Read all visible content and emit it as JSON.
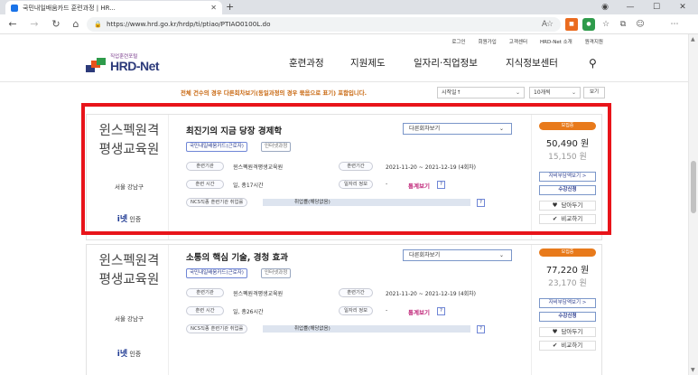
{
  "browser": {
    "tab_title": "국민내일배움카드 훈련과정 | HR...",
    "url": "https://www.hrd.go.kr/hrdp/ti/ptiao/PTIAO0100L.do"
  },
  "header": {
    "util_nav": [
      "로그인",
      "회원가입",
      "고객센터",
      "HRD-Net 소개",
      "원격지원"
    ],
    "logo_sub": "직업훈련포털",
    "logo_main": "HRD-Net",
    "main_nav": [
      "훈련과정",
      "지원제도",
      "일자리·직업정보",
      "지식정보센터"
    ]
  },
  "filter": {
    "notice": "전체 건수의 경우 다른회차보기(동일과정의 경우 묶음으로 표기) 포함입니다.",
    "sort_selected": "시작일↑",
    "page_size_selected": "10개씩",
    "view_button": "보기"
  },
  "courses": [
    {
      "org_line1": "윈스펙원격",
      "org_line2": "평생교육원",
      "location": "서울 강남구",
      "cert": "인증",
      "title": "최진기의 지금 당장 경제학",
      "round_select": "다른회차보기",
      "tags": [
        "국민내일배움카드(근로자)",
        "인터넷과정"
      ],
      "labels": {
        "org": "훈련기관",
        "period": "훈련기간",
        "time": "훈련 시간",
        "job": "일자리 정보",
        "ncs": "NCS직종 훈련기관 취업률"
      },
      "org_value": "윈스펙원격평생교육원",
      "period_value": "2021-11-20 ~ 2021-12-19 (4회차)",
      "time_value": "일, 총17시간",
      "job_value": "-",
      "stats_link": "통계보기",
      "ncs_value": "취업률(해당없음)",
      "badge": "모집중",
      "price": "50,490 원",
      "sub_price": "15,150 원",
      "self_pay_btn": "자비부담액보기 >",
      "apply_btn": "수강신청",
      "save_btn": "담아두기",
      "compare_btn": "비교하기"
    },
    {
      "org_line1": "윈스펙원격",
      "org_line2": "평생교육원",
      "location": "서울 강남구",
      "cert": "인증",
      "title": "소통의 핵심 기술, 경청 효과",
      "round_select": "다른회차보기",
      "tags": [
        "국민내일배움카드(근로자)",
        "인터넷과정"
      ],
      "labels": {
        "org": "훈련기관",
        "period": "훈련기간",
        "time": "훈련 시간",
        "job": "일자리 정보",
        "ncs": "NCS직종 훈련기관 취업률"
      },
      "org_value": "윈스펙원격평생교육원",
      "period_value": "2021-11-20 ~ 2021-12-19 (4회차)",
      "time_value": "일, 총26시간",
      "job_value": "-",
      "stats_link": "통계보기",
      "ncs_value": "취업률(해당없음)",
      "badge": "모집중",
      "price": "77,220 원",
      "sub_price": "23,170 원",
      "self_pay_btn": "자비부담액보기 >",
      "apply_btn": "수강신청",
      "save_btn": "담아두기",
      "compare_btn": "비교하기"
    }
  ],
  "colors": {
    "highlight_border": "#e8141a",
    "badge": "#e87a1b",
    "notice": "#c96a14",
    "stats": "#c0287a"
  }
}
